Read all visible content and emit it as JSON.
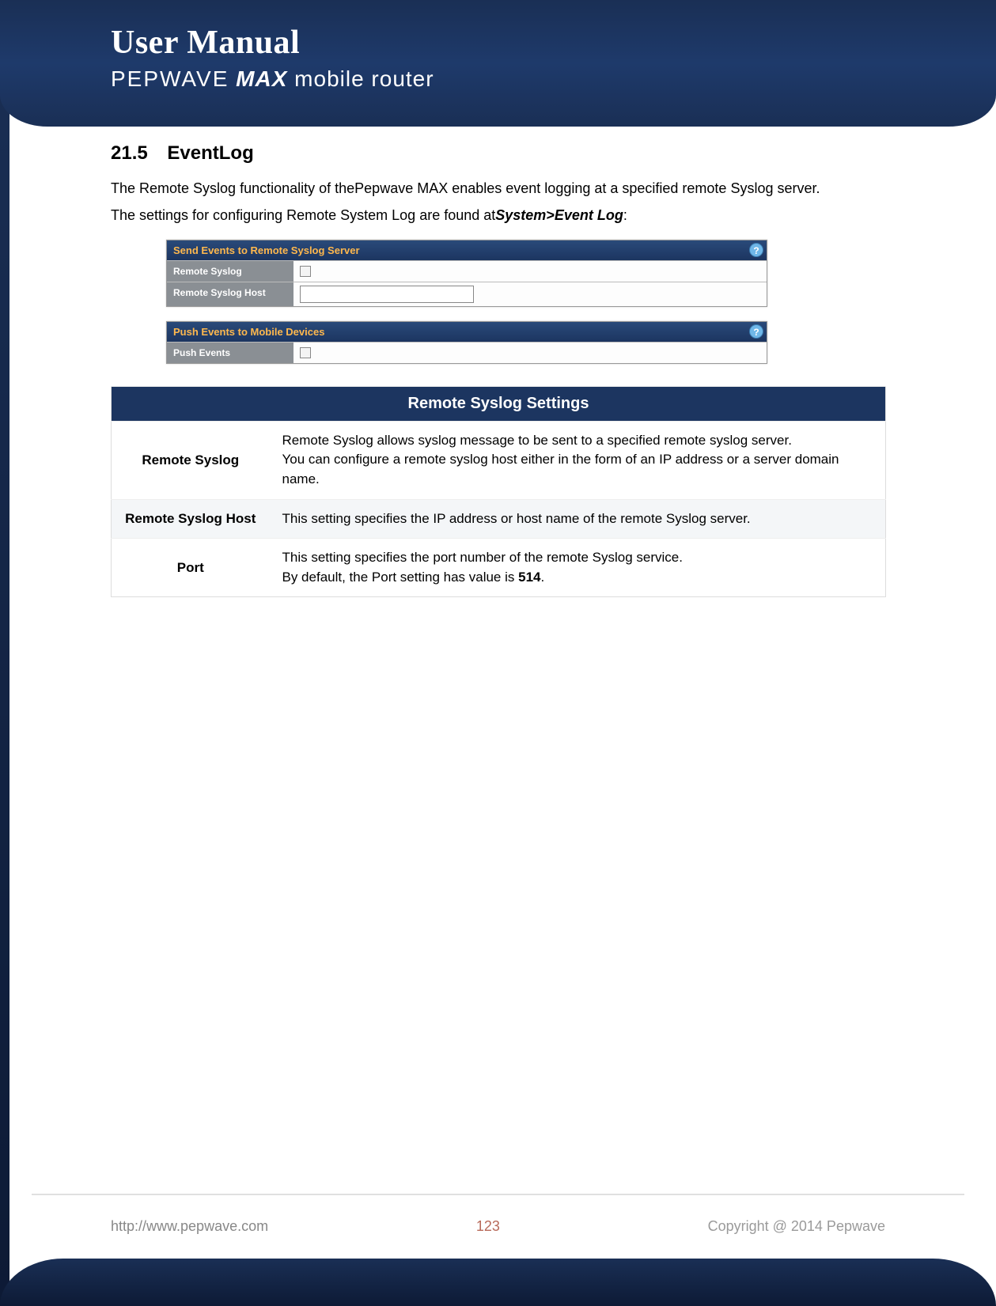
{
  "header": {
    "title": "User Manual",
    "brand": "PEPWAVE",
    "product": "MAX",
    "suffix": "mobile router"
  },
  "section": {
    "number": "21.5",
    "title": "EventLog",
    "para1": "The Remote Syslog functionality of thePepwave MAX enables event logging at a specified remote Syslog server.",
    "para2_pre": "The settings for configuring Remote System Log are found at",
    "para2_path": "System>Event Log",
    "para2_suffix": ":"
  },
  "ui_panels": {
    "panel1": {
      "header": "Send Events to Remote Syslog Server",
      "rows": [
        {
          "label": "Remote Syslog",
          "type": "checkbox"
        },
        {
          "label": "Remote Syslog Host",
          "type": "text",
          "value": ""
        }
      ]
    },
    "panel2": {
      "header": "Push Events to Mobile Devices",
      "rows": [
        {
          "label": "Push Events",
          "type": "checkbox"
        }
      ]
    },
    "help_glyph": "?"
  },
  "settings_table": {
    "title": "Remote Syslog Settings",
    "rows": [
      {
        "label": "Remote Syslog",
        "desc_line1": "Remote Syslog allows syslog message to be sent to a specified remote syslog server.",
        "desc_line2": "You can configure a remote syslog host either in the form of an IP address or a server domain name."
      },
      {
        "label": "Remote Syslog Host",
        "desc_line1": "This setting specifies the IP address or host name of the remote Syslog server.",
        "desc_line2": ""
      },
      {
        "label": "Port",
        "desc_line1": "This setting specifies the port number of the remote Syslog service.",
        "desc_line2_pre": "By default, the Port setting has value is ",
        "desc_line2_bold": "514",
        "desc_line2_suf": "."
      }
    ]
  },
  "footer": {
    "url": "http://www.pepwave.com",
    "page": "123",
    "copyright": "Copyright @ 2014 Pepwave"
  }
}
